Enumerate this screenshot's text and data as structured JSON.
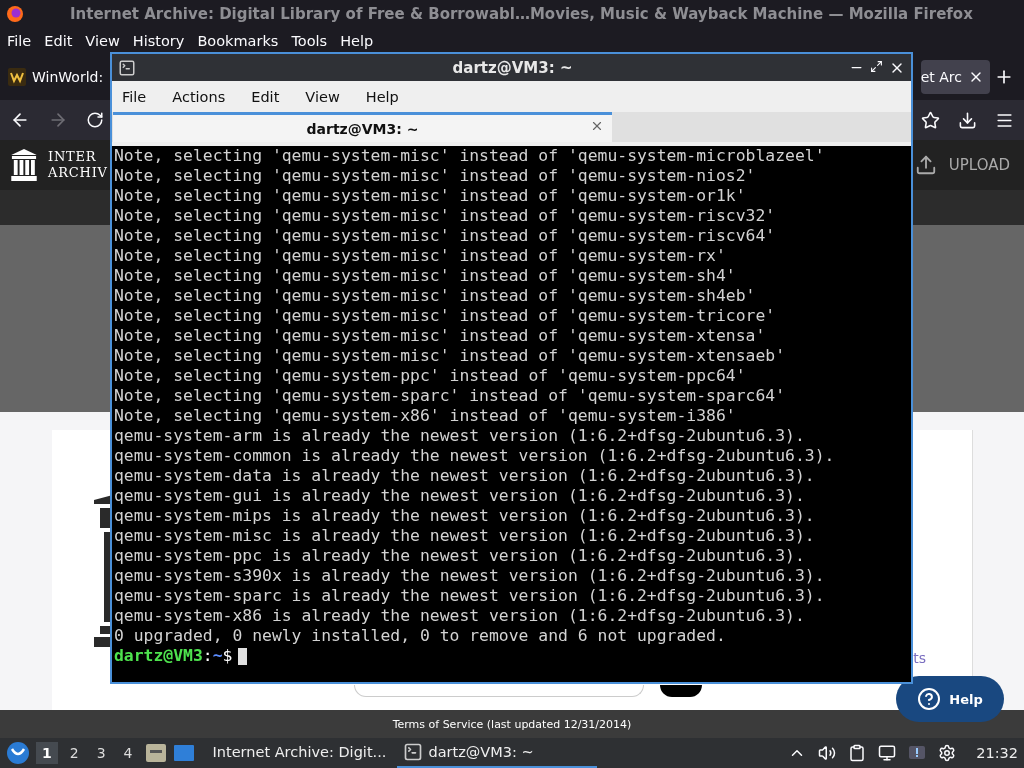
{
  "firefox": {
    "title": "Internet Archive: Digital Library of Free & Borrowabl…Movies, Music & Wayback Machine — Mozilla Firefox",
    "menu": [
      "File",
      "Edit",
      "View",
      "History",
      "Bookmarks",
      "Tools",
      "Help"
    ],
    "tabs": [
      {
        "label": "WinWorld:",
        "selected": false
      },
      {
        "label": "et Arc",
        "selected": true
      }
    ],
    "page": {
      "logo_lines": [
        "INTER",
        "ARCHIV"
      ],
      "upload": "UPLOAD",
      "link_fragment": "ts",
      "footer": "Terms of Service (last updated 12/31/2014)",
      "help_button": "Help"
    }
  },
  "terminal": {
    "title": "dartz@VM3: ~",
    "menu": [
      "File",
      "Actions",
      "Edit",
      "View",
      "Help"
    ],
    "tab_title": "dartz@VM3: ~",
    "lines": [
      "Note, selecting 'qemu-system-misc' instead of 'qemu-system-microblazeel'",
      "Note, selecting 'qemu-system-misc' instead of 'qemu-system-nios2'",
      "Note, selecting 'qemu-system-misc' instead of 'qemu-system-or1k'",
      "Note, selecting 'qemu-system-misc' instead of 'qemu-system-riscv32'",
      "Note, selecting 'qemu-system-misc' instead of 'qemu-system-riscv64'",
      "Note, selecting 'qemu-system-misc' instead of 'qemu-system-rx'",
      "Note, selecting 'qemu-system-misc' instead of 'qemu-system-sh4'",
      "Note, selecting 'qemu-system-misc' instead of 'qemu-system-sh4eb'",
      "Note, selecting 'qemu-system-misc' instead of 'qemu-system-tricore'",
      "Note, selecting 'qemu-system-misc' instead of 'qemu-system-xtensa'",
      "Note, selecting 'qemu-system-misc' instead of 'qemu-system-xtensaeb'",
      "Note, selecting 'qemu-system-ppc' instead of 'qemu-system-ppc64'",
      "Note, selecting 'qemu-system-sparc' instead of 'qemu-system-sparc64'",
      "Note, selecting 'qemu-system-x86' instead of 'qemu-system-i386'",
      "qemu-system-arm is already the newest version (1:6.2+dfsg-2ubuntu6.3).",
      "qemu-system-common is already the newest version (1:6.2+dfsg-2ubuntu6.3).",
      "qemu-system-data is already the newest version (1:6.2+dfsg-2ubuntu6.3).",
      "qemu-system-gui is already the newest version (1:6.2+dfsg-2ubuntu6.3).",
      "qemu-system-mips is already the newest version (1:6.2+dfsg-2ubuntu6.3).",
      "qemu-system-misc is already the newest version (1:6.2+dfsg-2ubuntu6.3).",
      "qemu-system-ppc is already the newest version (1:6.2+dfsg-2ubuntu6.3).",
      "qemu-system-s390x is already the newest version (1:6.2+dfsg-2ubuntu6.3).",
      "qemu-system-sparc is already the newest version (1:6.2+dfsg-2ubuntu6.3).",
      "qemu-system-x86 is already the newest version (1:6.2+dfsg-2ubuntu6.3).",
      "0 upgraded, 0 newly installed, 0 to remove and 6 not upgraded."
    ],
    "prompt": {
      "user_host": "dartz@VM3",
      "separator": ":",
      "path": "~",
      "symbol": "$"
    }
  },
  "taskbar": {
    "workspaces": [
      {
        "label": "1",
        "selected": true
      },
      {
        "label": "2",
        "selected": false
      },
      {
        "label": "3",
        "selected": false
      },
      {
        "label": "4",
        "selected": false
      }
    ],
    "tasks": [
      {
        "kind": "browser",
        "label": "Internet Archive: Digit...",
        "selected": false
      },
      {
        "kind": "terminal",
        "label": "dartz@VM3: ~",
        "selected": true
      }
    ],
    "clock": "21:32"
  }
}
